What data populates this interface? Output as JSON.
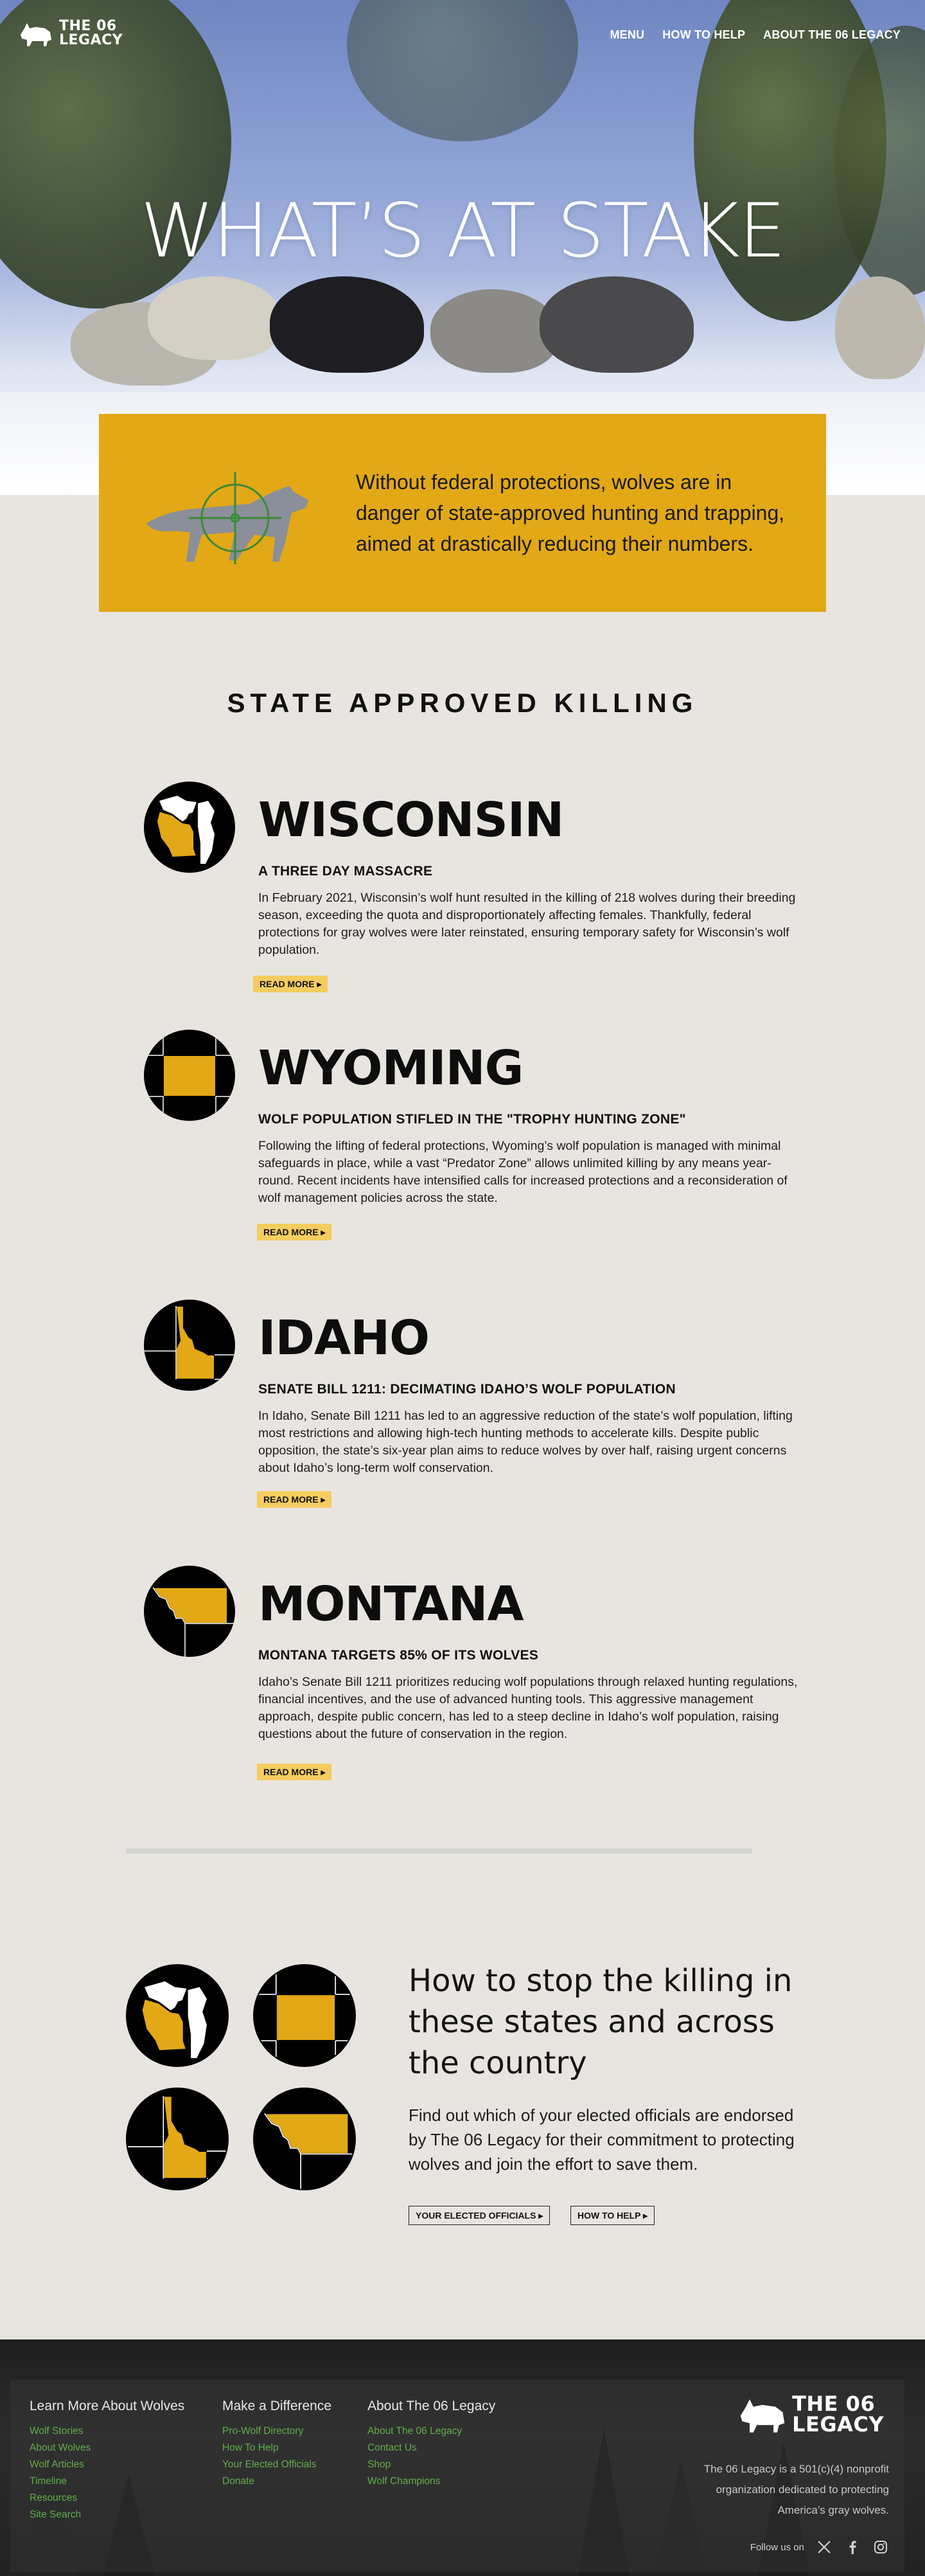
{
  "brand": {
    "logo_line1": "THE 06",
    "logo_line2": "LEGACY"
  },
  "nav": {
    "menu": "MENU",
    "how_to_help": "HOW TO HELP",
    "about": "ABOUT THE 06 LEGACY"
  },
  "hero": {
    "title": "WHAT’S AT STAKE"
  },
  "callout": {
    "text": "Without federal protections, wolves are in danger of state-approved hunting and trapping, aimed at drastically reducing their numbers."
  },
  "section_title": "STATE APPROVED KILLING",
  "states": [
    {
      "name": "WISCONSIN",
      "subtitle": "A THREE DAY MASSACRE",
      "body": "In February 2021, Wisconsin’s wolf hunt resulted in the killing of 218 wolves during their breeding season, exceeding the quota and disproportionately affecting females. Thankfully, federal protections for gray wolves were later reinstated, ensuring temporary safety for Wisconsin’s wolf population.",
      "read_more": "READ MORE ▸"
    },
    {
      "name": "WYOMING",
      "subtitle": "WOLF POPULATION STIFLED IN THE \"TROPHY HUNTING ZONE\"",
      "body": "Following the lifting of federal protections, Wyoming’s wolf population is managed with minimal safeguards in place, while a vast “Predator Zone” allows unlimited killing by any means year-round. Recent incidents have intensified calls for increased protections and a reconsideration of wolf management policies across the state.",
      "read_more": "READ MORE ▸"
    },
    {
      "name": "IDAHO",
      "subtitle": "SENATE BILL 1211: DECIMATING IDAHO’S WOLF POPULATION",
      "body": "In Idaho, Senate Bill 1211 has led to an aggressive reduction of the state’s wolf population, lifting most restrictions and allowing high-tech hunting methods to accelerate kills. Despite public opposition, the state’s six-year plan aims to reduce wolves by over half, raising urgent concerns about Idaho’s long-term wolf conservation.",
      "read_more": "READ MORE ▸"
    },
    {
      "name": "MONTANA",
      "subtitle": "MONTANA TARGETS 85% OF ITS WOLVES",
      "body": "Idaho’s Senate Bill 1211 prioritizes reducing wolf populations through relaxed hunting regulations, financial incentives, and the use of advanced hunting tools. This aggressive management approach, despite public concern, has led to a steep decline in Idaho’s wolf population, raising questions about the future of conservation in the region.",
      "read_more": "READ MORE ▸"
    }
  ],
  "cta": {
    "title": "How to stop the killing in these states and across the country",
    "body": "Find out which of your elected officials are endorsed by The 06 Legacy for their commitment to protecting wolves and join the effort to save them.",
    "btn_officials": "YOUR ELECTED OFFICIALS ▸",
    "btn_help": "HOW TO HELP ▸"
  },
  "footer": {
    "col1": {
      "title": "Learn More About Wolves",
      "links": [
        "Wolf Stories",
        "About Wolves",
        "Wolf Articles",
        "Timeline",
        "Resources",
        "Site Search"
      ]
    },
    "col2": {
      "title": "Make a Difference",
      "links": [
        "Pro-Wolf Directory",
        "How To Help",
        "Your Elected Officials",
        "Donate"
      ]
    },
    "col3": {
      "title": "About The 06 Legacy",
      "links": [
        "About The 06 Legacy",
        "Contact Us",
        "Shop",
        "Wolf Champions"
      ]
    },
    "description": "The 06 Legacy is a 501(c)(4) nonprofit organization dedicated to protecting America’s gray wolves.",
    "follow": "Follow us on"
  },
  "colors": {
    "accent": "#e2a816",
    "map_fill": "#e2a816",
    "link_green": "#5fae4c",
    "bg": "#e8e5e1"
  },
  "icons": [
    "wolf-logo-icon",
    "crosshair-icon",
    "x-icon",
    "facebook-icon",
    "instagram-icon"
  ]
}
